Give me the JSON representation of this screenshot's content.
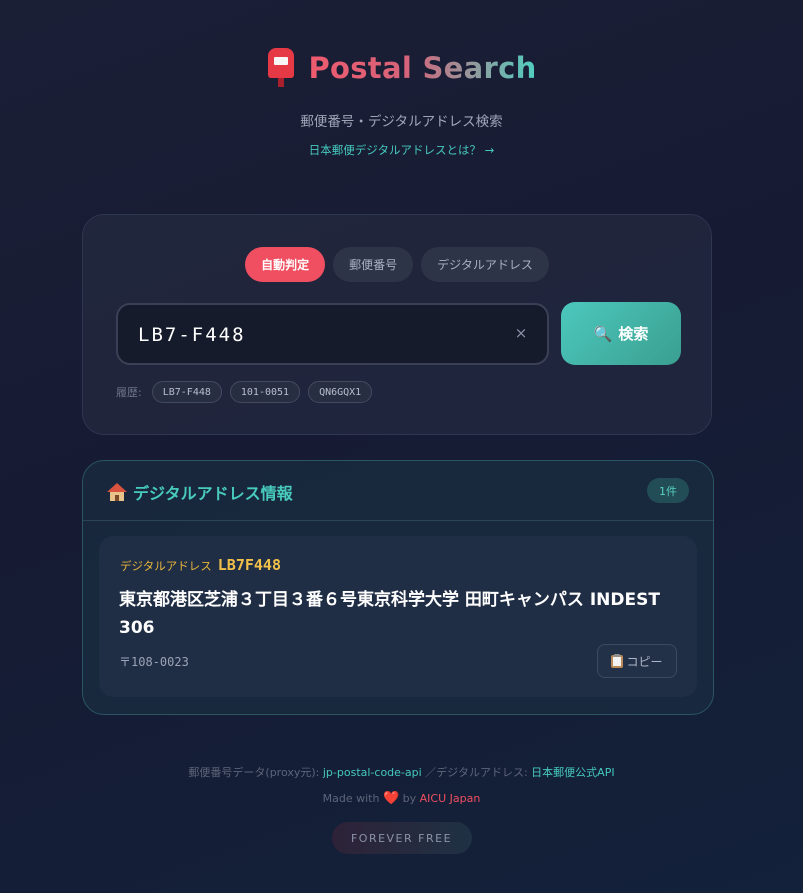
{
  "header": {
    "title": "Postal Search",
    "subtitle": "郵便番号・デジタルアドレス検索",
    "info_link": "日本郵便デジタルアドレスとは？ →"
  },
  "search": {
    "tabs": [
      {
        "label": "自動判定",
        "active": true
      },
      {
        "label": "郵便番号",
        "active": false
      },
      {
        "label": "デジタルアドレス",
        "active": false
      }
    ],
    "input_value": "LB7-F448",
    "clear_glyph": "×",
    "button_icon": "🔍",
    "button_label": "検索",
    "history_label": "履歴:",
    "history": [
      "LB7-F448",
      "101-0051",
      "QN6GQX1"
    ]
  },
  "result": {
    "title": "デジタルアドレス情報",
    "count": "1件",
    "items": [
      {
        "type_label": "デジタルアドレス",
        "code": "LB7F448",
        "address": "東京都港区芝浦３丁目３番６号東京科学大学 田町キャンパス INDEST 306",
        "postcode": "〒108-0023",
        "copy_label": "コピー"
      }
    ]
  },
  "footer": {
    "source_prefix": "郵便番号データ(proxy元): ",
    "source_postal": "jp-postal-code-api",
    "source_sep": " ／デジタルアドレス: ",
    "source_digital": "日本郵便公式API",
    "made_with": "Made with ",
    "heart": "❤️",
    "by": " by ",
    "author": "AICU Japan",
    "badge": "FOREVER FREE"
  },
  "colors": {
    "accent_red": "#ef4f60",
    "accent_teal": "#4cc8bd",
    "accent_gold": "#f1c04a"
  }
}
